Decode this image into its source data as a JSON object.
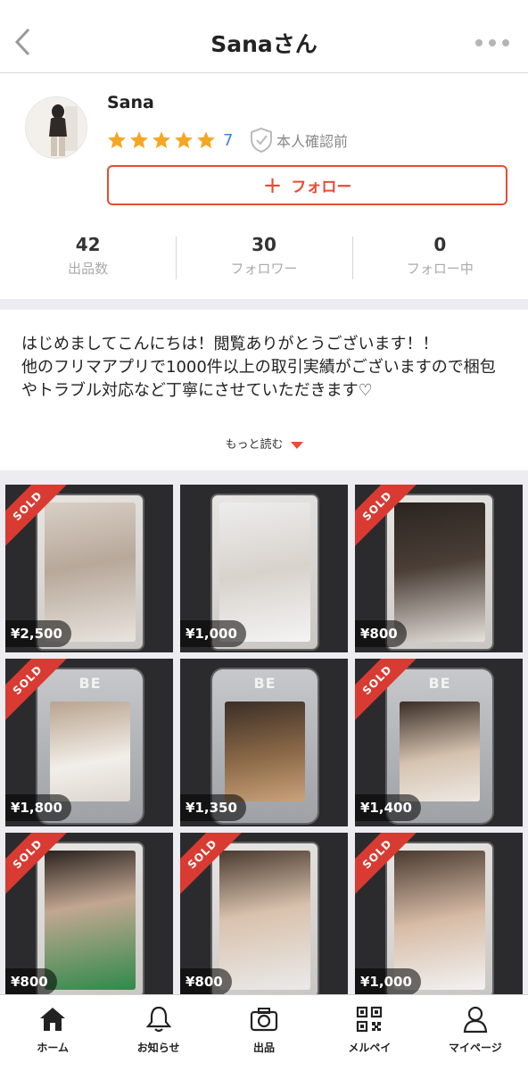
{
  "header": {
    "title": "Sanaさん"
  },
  "profile": {
    "name": "Sana",
    "rating_stars": 5,
    "rating_count": "7",
    "verification": "本人確認前",
    "follow_label": "フォロー"
  },
  "stats": [
    {
      "value": "42",
      "label": "出品数"
    },
    {
      "value": "30",
      "label": "フォロワー"
    },
    {
      "value": "0",
      "label": "フォロー中"
    }
  ],
  "bio": {
    "text": "はじめましてこんにちは！閲覧ありがとうございます！！\n他のフリマアプリで1000件以上の取引実績がございますので梱包やトラブル対応など丁寧にさせていただきます♡",
    "read_more": "もっと読む"
  },
  "items": [
    {
      "price": "¥2,500",
      "sold": true,
      "sold_label": "SOLD",
      "style": "plain"
    },
    {
      "price": "¥1,000",
      "sold": false,
      "sold_label": "",
      "style": "plain"
    },
    {
      "price": "¥800",
      "sold": true,
      "sold_label": "SOLD",
      "style": "plain"
    },
    {
      "price": "¥1,800",
      "sold": true,
      "sold_label": "SOLD",
      "style": "be",
      "logo": "BE"
    },
    {
      "price": "¥1,350",
      "sold": false,
      "sold_label": "",
      "style": "be",
      "logo": "BE"
    },
    {
      "price": "¥1,400",
      "sold": true,
      "sold_label": "SOLD",
      "style": "be",
      "logo": "BE"
    },
    {
      "price": "¥800",
      "sold": true,
      "sold_label": "SOLD",
      "style": "plain"
    },
    {
      "price": "¥800",
      "sold": true,
      "sold_label": "SOLD",
      "style": "plain"
    },
    {
      "price": "¥1,000",
      "sold": true,
      "sold_label": "SOLD",
      "style": "plain"
    }
  ],
  "tabbar": [
    {
      "label": "ホーム",
      "icon": "home-icon"
    },
    {
      "label": "お知らせ",
      "icon": "bell-icon"
    },
    {
      "label": "出品",
      "icon": "camera-icon"
    },
    {
      "label": "メルペイ",
      "icon": "qr-code-icon"
    },
    {
      "label": "マイページ",
      "icon": "person-icon"
    }
  ],
  "colors": {
    "accent": "#e94b35",
    "sold": "#d93b32",
    "link": "#3a86d8",
    "star": "#f5a623"
  }
}
